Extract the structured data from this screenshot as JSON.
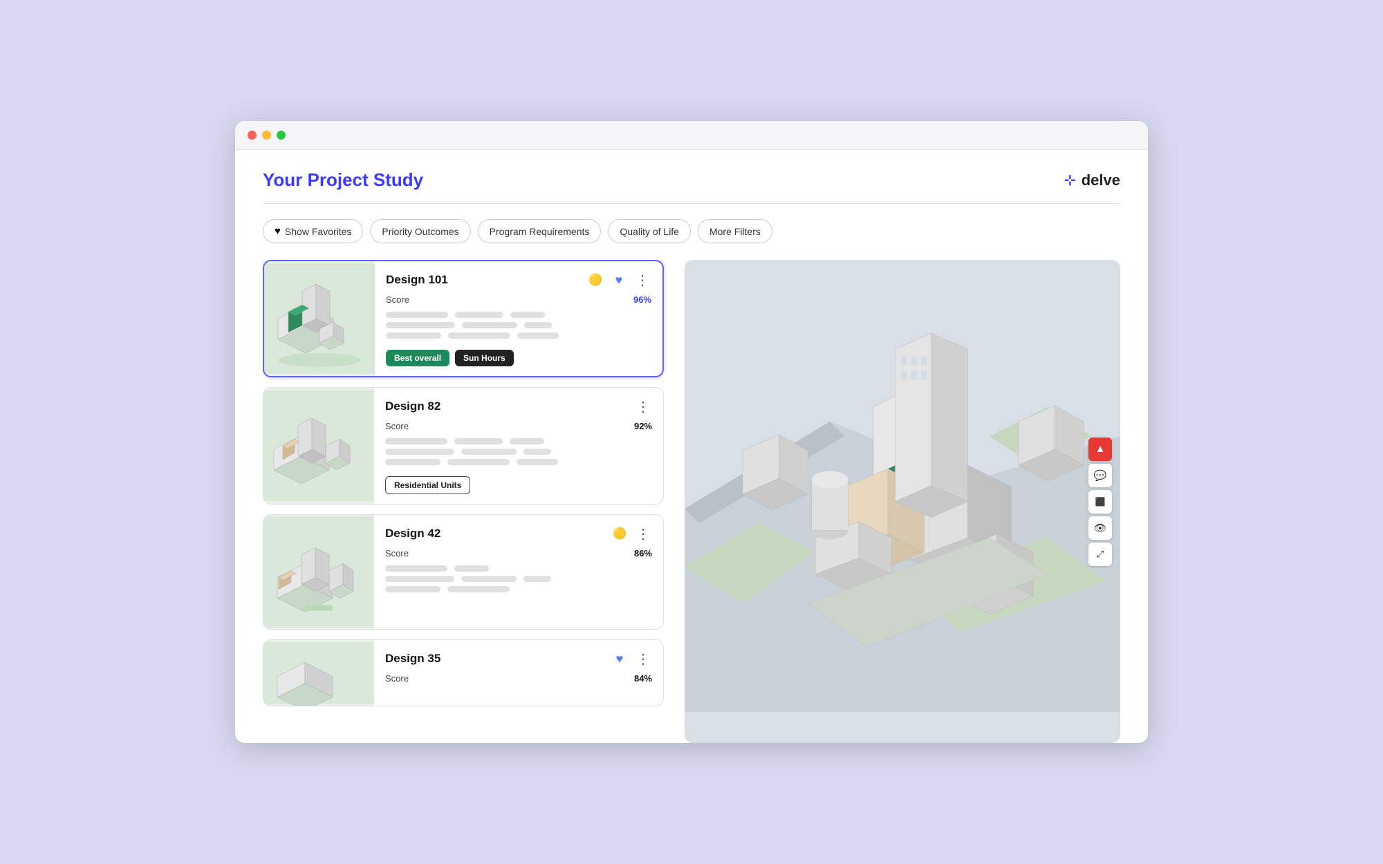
{
  "window": {
    "title": "Your Project Study"
  },
  "header": {
    "title": "Your Project Study",
    "logo_text": "delve",
    "logo_icon": "⊹"
  },
  "filters": [
    {
      "id": "show-favorites",
      "label": "Show Favorites",
      "hasIcon": true,
      "icon": "♥"
    },
    {
      "id": "priority-outcomes",
      "label": "Priority Outcomes",
      "hasIcon": false
    },
    {
      "id": "program-requirements",
      "label": "Program Requirements",
      "hasIcon": false
    },
    {
      "id": "quality-of-life",
      "label": "Quality of Life",
      "hasIcon": false
    },
    {
      "id": "more-filters",
      "label": "More Filters",
      "hasIcon": false
    }
  ],
  "designs": [
    {
      "id": "design-101",
      "name": "Design 101",
      "score_label": "Score",
      "score": "96%",
      "score_color": "#3b3bff",
      "selected": true,
      "has_comment": true,
      "has_heart": true,
      "heart_filled": true,
      "tags": [
        {
          "label": "Best overall",
          "style": "green"
        },
        {
          "label": "Sun Hours",
          "style": "dark"
        }
      ]
    },
    {
      "id": "design-82",
      "name": "Design 82",
      "score_label": "Score",
      "score": "92%",
      "score_color": "#111",
      "selected": false,
      "has_comment": false,
      "has_heart": false,
      "heart_filled": false,
      "tags": [
        {
          "label": "Residential Units",
          "style": "outlined"
        }
      ]
    },
    {
      "id": "design-42",
      "name": "Design 42",
      "score_label": "Score",
      "score": "86%",
      "score_color": "#111",
      "selected": false,
      "has_comment": true,
      "has_heart": false,
      "heart_filled": false,
      "tags": []
    },
    {
      "id": "design-35",
      "name": "Design 35",
      "score_label": "Score",
      "score": "84%",
      "score_color": "#111",
      "selected": false,
      "has_comment": false,
      "has_heart": true,
      "heart_filled": true,
      "tags": []
    }
  ],
  "map_controls": [
    {
      "id": "navigate",
      "icon": "▲",
      "style": "red"
    },
    {
      "id": "comment",
      "icon": "💬",
      "style": "normal"
    },
    {
      "id": "measure",
      "icon": "⬛",
      "style": "normal"
    },
    {
      "id": "view",
      "icon": "👁",
      "style": "normal"
    },
    {
      "id": "fullscreen",
      "icon": "⤢",
      "style": "normal"
    }
  ]
}
